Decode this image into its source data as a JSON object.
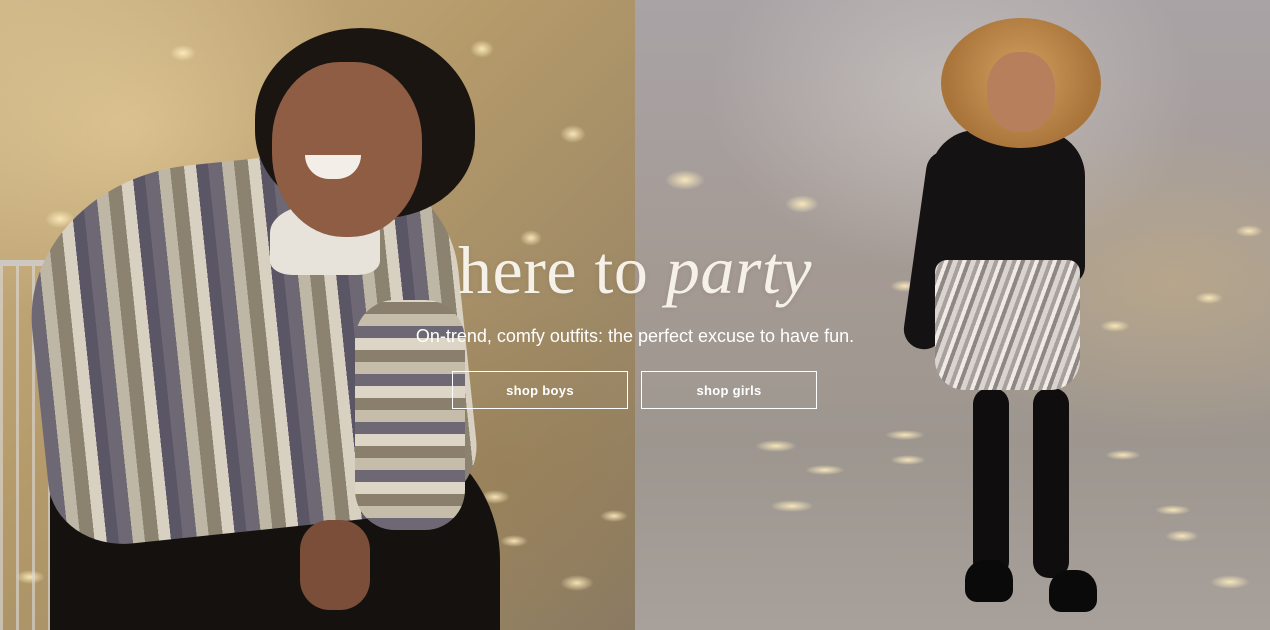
{
  "hero": {
    "headline_plain": "here to",
    "headline_italic": "party",
    "subheadline": "On-trend, comfy outfits: the perfect excuse to have fun.",
    "cta_boys": "shop boys",
    "cta_girls": "shop girls"
  },
  "colors": {
    "text": "#ffffff",
    "headline": "#f6f1e8",
    "left_bg": "#b59a6a",
    "right_bg": "#a49a93"
  }
}
